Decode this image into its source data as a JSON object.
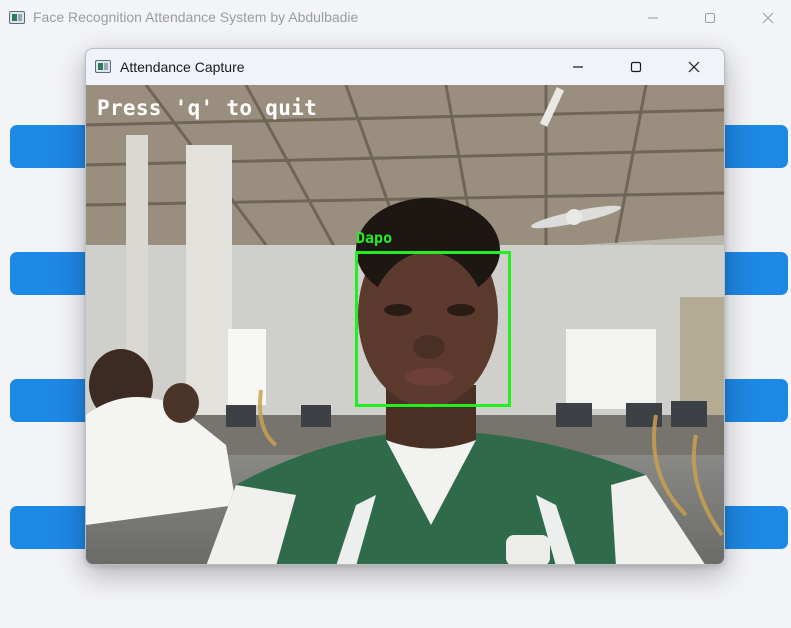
{
  "main_window": {
    "title": "Face Recognition Attendance System by Abdulbadie",
    "buttons_left": [
      "",
      "",
      "",
      ""
    ],
    "buttons_right": [
      "",
      "",
      "",
      ""
    ],
    "button_color": "#1e88e5"
  },
  "popup_window": {
    "title": "Attendance Capture",
    "overlay_text": "Press 'q' to quit",
    "detected_face": {
      "name": "Dapo",
      "box_color": "#22ee22"
    }
  },
  "icons": {
    "app": "window-app-icon",
    "minimize": "minimize-icon",
    "maximize": "maximize-icon",
    "close": "close-icon"
  }
}
